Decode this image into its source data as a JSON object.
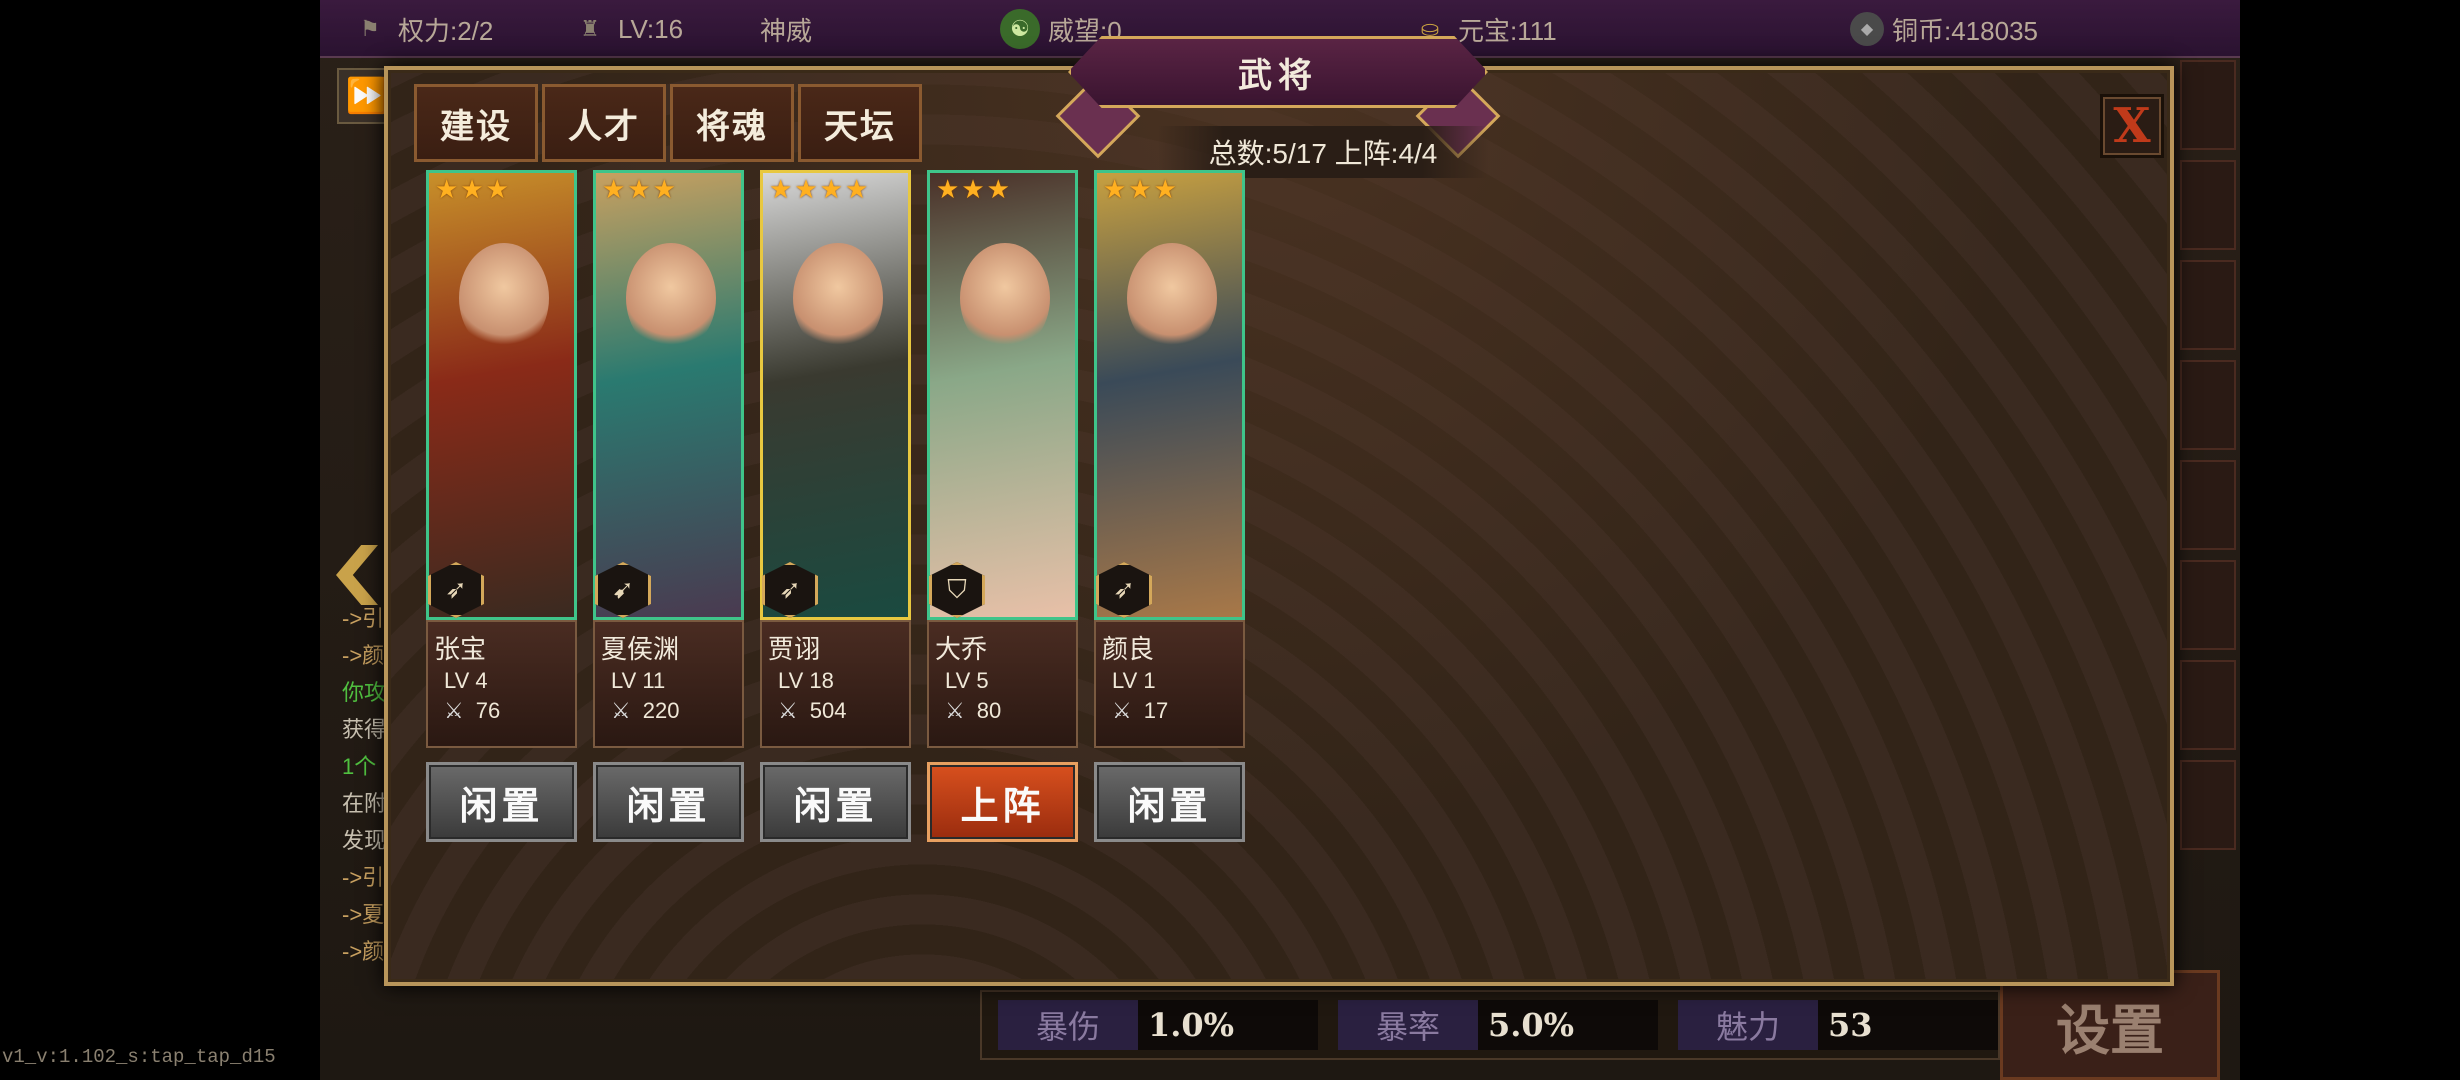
{
  "topbar": {
    "power": "权力:2/2",
    "level": "LV:16",
    "rank": "神威",
    "prestige": "威望:0",
    "ingot": "元宝:111",
    "coins": "铜币:418035"
  },
  "left_log": [
    "->引",
    "->颜",
    "你攻",
    "获得",
    "1个",
    "在附",
    "发现",
    "->引",
    "->夏",
    "->颜"
  ],
  "stats": [
    {
      "label": "暴伤",
      "value": "1.0%"
    },
    {
      "label": "暴率",
      "value": "5.0%"
    },
    {
      "label": "魅力",
      "value": "53"
    }
  ],
  "settings_label": "设置",
  "version": "v1_v:1.102_s:tap_tap_d15",
  "modal": {
    "title": "武将",
    "close_label": "X",
    "total_info": "总数:5/17  上阵:4/4",
    "tabs": [
      "建设",
      "人才",
      "将魂",
      "天坛"
    ],
    "heroes": [
      {
        "name": "张宝",
        "lv": "LV  4",
        "power": "76",
        "stars": 3,
        "class_icon": "spear-icon",
        "status": "闲置",
        "active": false,
        "frame": "green",
        "palette": [
          "#c8902a",
          "#8a2a18",
          "#3a2a20"
        ]
      },
      {
        "name": "夏侯渊",
        "lv": "LV  11",
        "power": "220",
        "stars": 3,
        "class_icon": "bow-icon",
        "status": "闲置",
        "active": false,
        "frame": "green",
        "palette": [
          "#c8a060",
          "#2a7a70",
          "#4a3a50"
        ]
      },
      {
        "name": "贾诩",
        "lv": "LV  18",
        "power": "504",
        "stars": 4,
        "class_icon": "spear-icon",
        "status": "闲置",
        "active": false,
        "frame": "gold",
        "palette": [
          "#d8d8d8",
          "#3a3a30",
          "#1a4a40"
        ]
      },
      {
        "name": "大乔",
        "lv": "LV  5",
        "power": "80",
        "stars": 3,
        "class_icon": "shield-icon",
        "status": "上阵",
        "active": true,
        "frame": "green",
        "palette": [
          "#4a3028",
          "#8aa888",
          "#e8c0a8"
        ]
      },
      {
        "name": "颜良",
        "lv": "LV  1",
        "power": "17",
        "stars": 3,
        "class_icon": "spear-icon",
        "status": "闲置",
        "active": false,
        "frame": "green",
        "palette": [
          "#c8a040",
          "#3a4a58",
          "#a87848"
        ]
      }
    ]
  }
}
